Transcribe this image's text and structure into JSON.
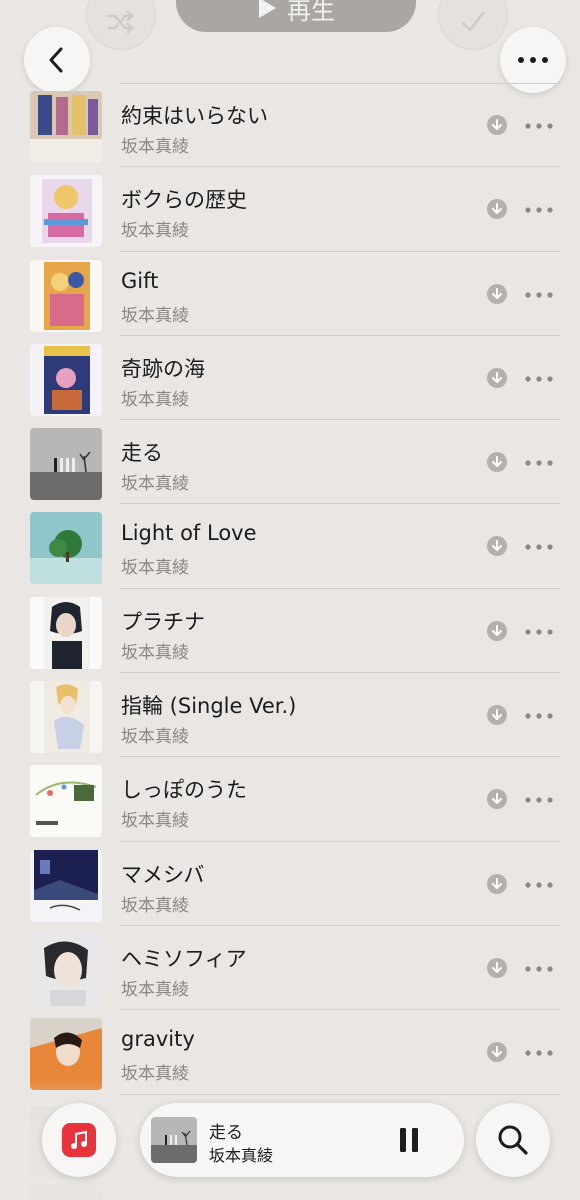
{
  "header": {
    "play_label": "再生",
    "shuffle_icon": "shuffle-icon",
    "check_icon": "checkmark-icon",
    "back_icon": "chevron-left-icon",
    "more_icon": "ellipsis-icon"
  },
  "songs": [
    {
      "title": "約束はいらない",
      "artist": "坂本真綾"
    },
    {
      "title": "ボクらの歴史",
      "artist": "坂本真綾"
    },
    {
      "title": "Gift",
      "artist": "坂本真綾"
    },
    {
      "title": "奇跡の海",
      "artist": "坂本真綾"
    },
    {
      "title": "走る",
      "artist": "坂本真綾"
    },
    {
      "title": "Light of Love",
      "artist": "坂本真綾"
    },
    {
      "title": "プラチナ",
      "artist": "坂本真綾"
    },
    {
      "title": "指輪 (Single Ver.)",
      "artist": "坂本真綾"
    },
    {
      "title": "しっぽのうた",
      "artist": "坂本真綾"
    },
    {
      "title": "マメシバ",
      "artist": "坂本真綾"
    },
    {
      "title": "ヘミソフィア",
      "artist": "坂本真綾"
    },
    {
      "title": "gravity",
      "artist": "坂本真綾"
    }
  ],
  "now_playing": {
    "title": "走る",
    "artist": "坂本真綾"
  },
  "colors": {
    "background": "#e9e6e3",
    "accent": "#e8333c",
    "secondary_text": "#8a8784"
  }
}
